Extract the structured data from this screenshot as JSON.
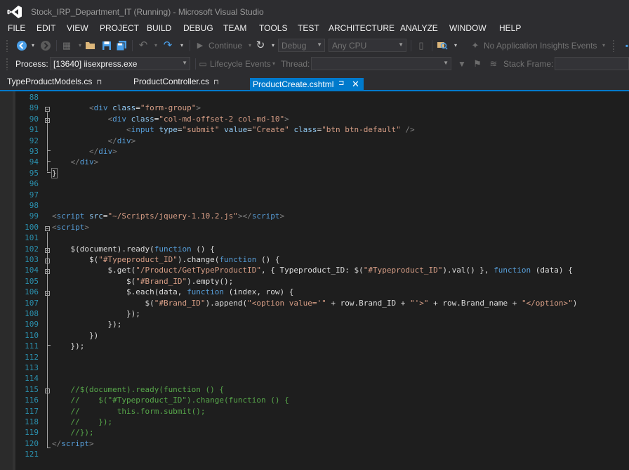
{
  "title": "Stock_IRP_Department_IT (Running) - Microsoft Visual Studio",
  "menu": [
    "FILE",
    "EDIT",
    "VIEW",
    "PROJECT",
    "BUILD",
    "DEBUG",
    "TEAM",
    "TOOLS",
    "TEST",
    "ARCHITECTURE",
    "ANALYZE",
    "WINDOW",
    "HELP"
  ],
  "toolbar": {
    "continue_label": "Continue",
    "config_value": "Debug",
    "platform_value": "Any CPU",
    "insights_label": "No Application Insights Events"
  },
  "debug_toolbar": {
    "process_label": "Process:",
    "process_value": "[13640] iisexpress.exe",
    "lifecycle_label": "Lifecycle Events",
    "thread_label": "Thread:",
    "stack_frame_label": "Stack Frame:"
  },
  "tabs": [
    {
      "label": "TypeProductModels.cs",
      "active": false
    },
    {
      "label": "ProductController.cs",
      "active": false
    },
    {
      "label": "ProductCreate.cshtml",
      "active": true
    }
  ],
  "editor": {
    "line_numbers": [
      "88",
      "89",
      "90",
      "91",
      "92",
      "93",
      "94",
      "95",
      "96",
      "97",
      "98",
      "99",
      "100",
      "101",
      "102",
      "103",
      "104",
      "105",
      "106",
      "107",
      "108",
      "109",
      "110",
      "111",
      "112",
      "113",
      "114",
      "115",
      "116",
      "117",
      "118",
      "119",
      "120",
      "121"
    ]
  },
  "colors": {
    "accent": "#007acc",
    "background": "#1e1e1e",
    "chrome": "#2d2d30",
    "keyword": "#569cd6",
    "string": "#d69d85",
    "comment": "#57a64a",
    "line_number": "#2b91af"
  },
  "icons": [
    "visual-studio-logo-icon",
    "back-icon",
    "forward-icon",
    "new-project-icon",
    "open-folder-icon",
    "save-icon",
    "save-all-icon",
    "undo-icon",
    "redo-icon",
    "play-icon",
    "restart-icon",
    "find-icon",
    "insights-icon",
    "filter-icon",
    "pin-icon",
    "close-icon"
  ]
}
